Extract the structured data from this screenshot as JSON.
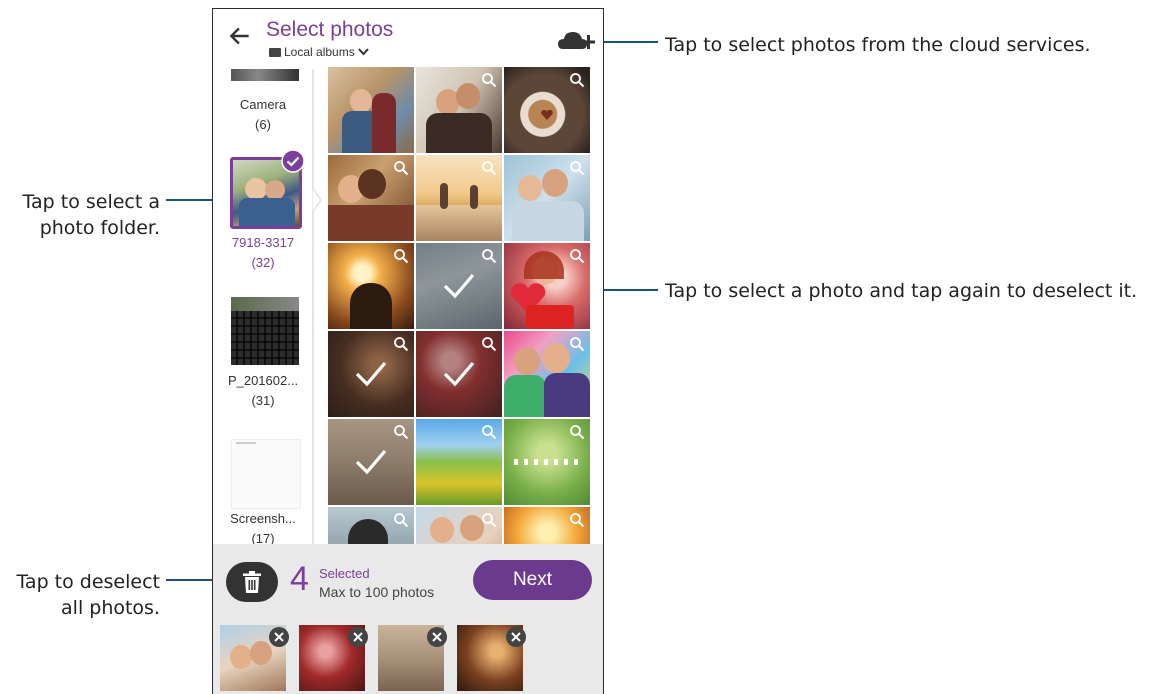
{
  "app": {
    "title": "Select photos",
    "album_selector": "Local albums"
  },
  "folders": [
    {
      "name": "Camera",
      "count": "(6)"
    },
    {
      "name": "7918-3317",
      "count": "(32)"
    },
    {
      "name": "P_201602...",
      "count": "(31)"
    },
    {
      "name": "Screensh...",
      "count": "(17)"
    }
  ],
  "selection": {
    "count": "4",
    "selected_label": "Selected",
    "max_label": "Max to 100 photos"
  },
  "buttons": {
    "next": "Next"
  },
  "callouts": {
    "cloud": "Tap to select photos from the cloud services.",
    "folder_line1": "Tap to select a",
    "folder_line2": "photo folder.",
    "photo": "Tap to select a photo and tap again to deselect it.",
    "deselect_line1": "Tap to deselect",
    "deselect_line2": "all photos."
  },
  "colors": {
    "accent": "#7b3f9a",
    "next_button": "#6b3a8e",
    "leader_line": "#1f4f82"
  },
  "icons": [
    "back-arrow-icon",
    "folder-icon",
    "chevron-down-icon",
    "cloud-add-icon",
    "checkmark-icon",
    "search-icon",
    "trash-icon",
    "close-icon"
  ]
}
